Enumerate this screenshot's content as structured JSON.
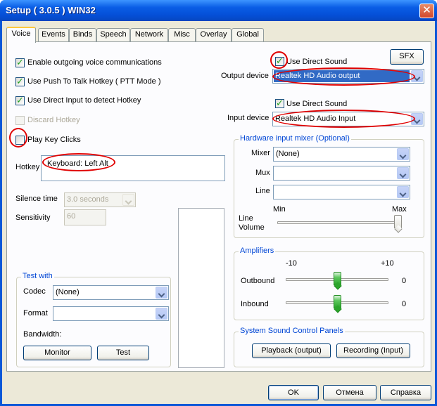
{
  "window": {
    "title": "Setup ( 3.0.5 ) WIN32"
  },
  "tabs": [
    "Voice",
    "Events",
    "Binds",
    "Speech",
    "Network",
    "Misc",
    "Overlay",
    "Global"
  ],
  "voice": {
    "enable_outgoing": "Enable outgoing voice communications",
    "push_to_talk": "Use Push To Talk Hotkey ( PTT Mode )",
    "direct_input": "Use Direct Input to detect Hotkey",
    "discard_hotkey": "Discard Hotkey",
    "play_key_clicks": "Play Key Clicks",
    "hotkey_label": "Hotkey",
    "hotkey_value": "Keyboard: Left Alt",
    "silence_time_label": "Silence time",
    "silence_time_value": "3.0 seconds",
    "sensitivity_label": "Sensitivity",
    "sensitivity_value": "60"
  },
  "output": {
    "use_direct_sound": "Use Direct Sound",
    "sfx_button": "SFX",
    "device_label": "Output device",
    "device_value": "Realtek HD Audio output"
  },
  "input": {
    "use_direct_sound": "Use Direct Sound",
    "device_label": "Input device",
    "device_value": "Realtek HD Audio Input"
  },
  "mixer": {
    "title": "Hardware input mixer (Optional)",
    "mixer_label": "Mixer",
    "mixer_value": "(None)",
    "mux_label": "Mux",
    "line_label": "Line",
    "min_label": "Min",
    "max_label": "Max",
    "line_volume_label_1": "Line",
    "line_volume_label_2": "Volume",
    "line_volume_level": 1.0
  },
  "amplifiers": {
    "title": "Amplifiers",
    "min_label": "-10",
    "max_label": "+10",
    "outbound_label": "Outbound",
    "outbound_value": "0",
    "inbound_label": "Inbound",
    "inbound_value": "0"
  },
  "test_with": {
    "title": "Test with",
    "codec_label": "Codec",
    "codec_value": "(None)",
    "format_label": "Format",
    "bandwidth_label": "Bandwidth:",
    "monitor_button": "Monitor",
    "test_button": "Test"
  },
  "sound_panels": {
    "title": "System Sound Control Panels",
    "playback_button": "Playback (output)",
    "recording_button": "Recording (Input)"
  },
  "footer": {
    "ok": "OK",
    "cancel": "Отмена",
    "help": "Справка"
  }
}
